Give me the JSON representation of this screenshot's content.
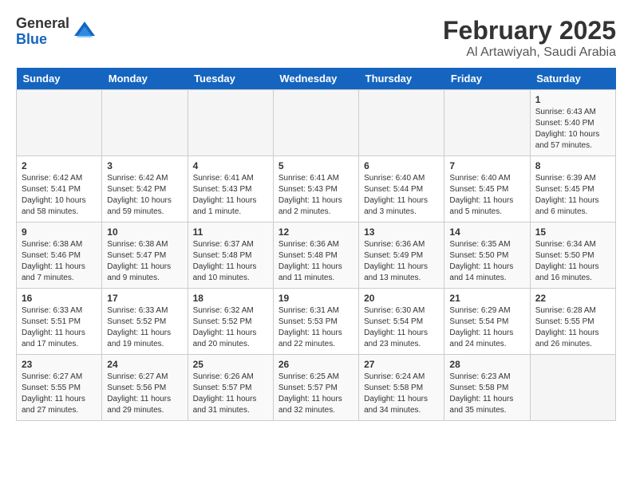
{
  "logo": {
    "general": "General",
    "blue": "Blue"
  },
  "title": "February 2025",
  "subtitle": "Al Artawiyah, Saudi Arabia",
  "weekdays": [
    "Sunday",
    "Monday",
    "Tuesday",
    "Wednesday",
    "Thursday",
    "Friday",
    "Saturday"
  ],
  "weeks": [
    [
      {
        "day": "",
        "info": ""
      },
      {
        "day": "",
        "info": ""
      },
      {
        "day": "",
        "info": ""
      },
      {
        "day": "",
        "info": ""
      },
      {
        "day": "",
        "info": ""
      },
      {
        "day": "",
        "info": ""
      },
      {
        "day": "1",
        "info": "Sunrise: 6:43 AM\nSunset: 5:40 PM\nDaylight: 10 hours and 57 minutes."
      }
    ],
    [
      {
        "day": "2",
        "info": "Sunrise: 6:42 AM\nSunset: 5:41 PM\nDaylight: 10 hours and 58 minutes."
      },
      {
        "day": "3",
        "info": "Sunrise: 6:42 AM\nSunset: 5:42 PM\nDaylight: 10 hours and 59 minutes."
      },
      {
        "day": "4",
        "info": "Sunrise: 6:41 AM\nSunset: 5:43 PM\nDaylight: 11 hours and 1 minute."
      },
      {
        "day": "5",
        "info": "Sunrise: 6:41 AM\nSunset: 5:43 PM\nDaylight: 11 hours and 2 minutes."
      },
      {
        "day": "6",
        "info": "Sunrise: 6:40 AM\nSunset: 5:44 PM\nDaylight: 11 hours and 3 minutes."
      },
      {
        "day": "7",
        "info": "Sunrise: 6:40 AM\nSunset: 5:45 PM\nDaylight: 11 hours and 5 minutes."
      },
      {
        "day": "8",
        "info": "Sunrise: 6:39 AM\nSunset: 5:45 PM\nDaylight: 11 hours and 6 minutes."
      }
    ],
    [
      {
        "day": "9",
        "info": "Sunrise: 6:38 AM\nSunset: 5:46 PM\nDaylight: 11 hours and 7 minutes."
      },
      {
        "day": "10",
        "info": "Sunrise: 6:38 AM\nSunset: 5:47 PM\nDaylight: 11 hours and 9 minutes."
      },
      {
        "day": "11",
        "info": "Sunrise: 6:37 AM\nSunset: 5:48 PM\nDaylight: 11 hours and 10 minutes."
      },
      {
        "day": "12",
        "info": "Sunrise: 6:36 AM\nSunset: 5:48 PM\nDaylight: 11 hours and 11 minutes."
      },
      {
        "day": "13",
        "info": "Sunrise: 6:36 AM\nSunset: 5:49 PM\nDaylight: 11 hours and 13 minutes."
      },
      {
        "day": "14",
        "info": "Sunrise: 6:35 AM\nSunset: 5:50 PM\nDaylight: 11 hours and 14 minutes."
      },
      {
        "day": "15",
        "info": "Sunrise: 6:34 AM\nSunset: 5:50 PM\nDaylight: 11 hours and 16 minutes."
      }
    ],
    [
      {
        "day": "16",
        "info": "Sunrise: 6:33 AM\nSunset: 5:51 PM\nDaylight: 11 hours and 17 minutes."
      },
      {
        "day": "17",
        "info": "Sunrise: 6:33 AM\nSunset: 5:52 PM\nDaylight: 11 hours and 19 minutes."
      },
      {
        "day": "18",
        "info": "Sunrise: 6:32 AM\nSunset: 5:52 PM\nDaylight: 11 hours and 20 minutes."
      },
      {
        "day": "19",
        "info": "Sunrise: 6:31 AM\nSunset: 5:53 PM\nDaylight: 11 hours and 22 minutes."
      },
      {
        "day": "20",
        "info": "Sunrise: 6:30 AM\nSunset: 5:54 PM\nDaylight: 11 hours and 23 minutes."
      },
      {
        "day": "21",
        "info": "Sunrise: 6:29 AM\nSunset: 5:54 PM\nDaylight: 11 hours and 24 minutes."
      },
      {
        "day": "22",
        "info": "Sunrise: 6:28 AM\nSunset: 5:55 PM\nDaylight: 11 hours and 26 minutes."
      }
    ],
    [
      {
        "day": "23",
        "info": "Sunrise: 6:27 AM\nSunset: 5:55 PM\nDaylight: 11 hours and 27 minutes."
      },
      {
        "day": "24",
        "info": "Sunrise: 6:27 AM\nSunset: 5:56 PM\nDaylight: 11 hours and 29 minutes."
      },
      {
        "day": "25",
        "info": "Sunrise: 6:26 AM\nSunset: 5:57 PM\nDaylight: 11 hours and 31 minutes."
      },
      {
        "day": "26",
        "info": "Sunrise: 6:25 AM\nSunset: 5:57 PM\nDaylight: 11 hours and 32 minutes."
      },
      {
        "day": "27",
        "info": "Sunrise: 6:24 AM\nSunset: 5:58 PM\nDaylight: 11 hours and 34 minutes."
      },
      {
        "day": "28",
        "info": "Sunrise: 6:23 AM\nSunset: 5:58 PM\nDaylight: 11 hours and 35 minutes."
      },
      {
        "day": "",
        "info": ""
      }
    ]
  ]
}
